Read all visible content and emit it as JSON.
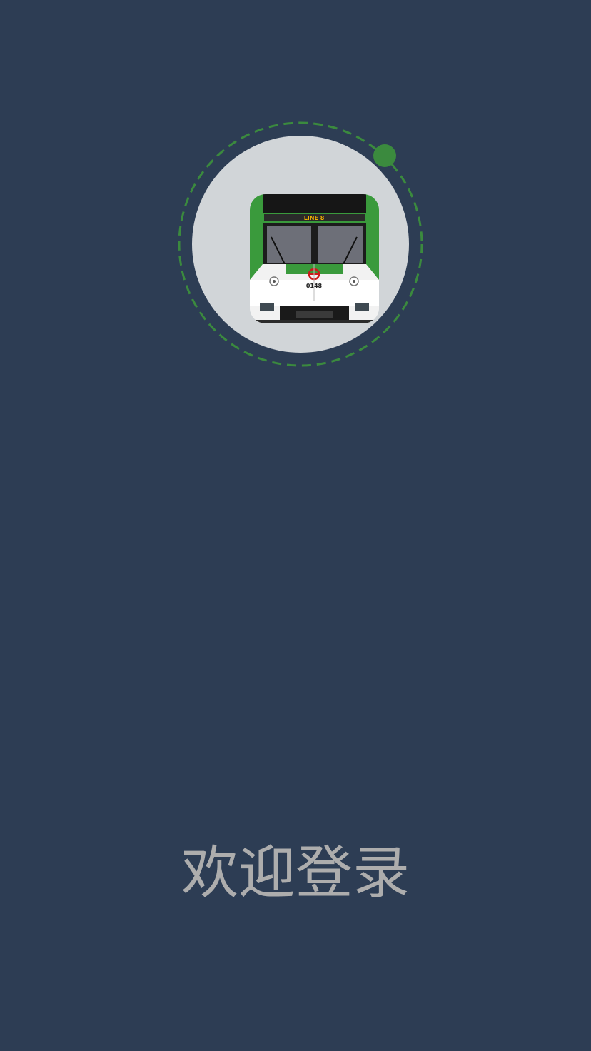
{
  "welcome": {
    "title": "欢迎登录"
  },
  "logo": {
    "icon": "subway-train-icon",
    "badge_text": "LINE 8",
    "train_number": "0148",
    "ring_color": "#3b8a3e",
    "circle_color": "#d1d5d8"
  },
  "theme": {
    "background": "#2d3d54",
    "text_color": "#adadad"
  }
}
